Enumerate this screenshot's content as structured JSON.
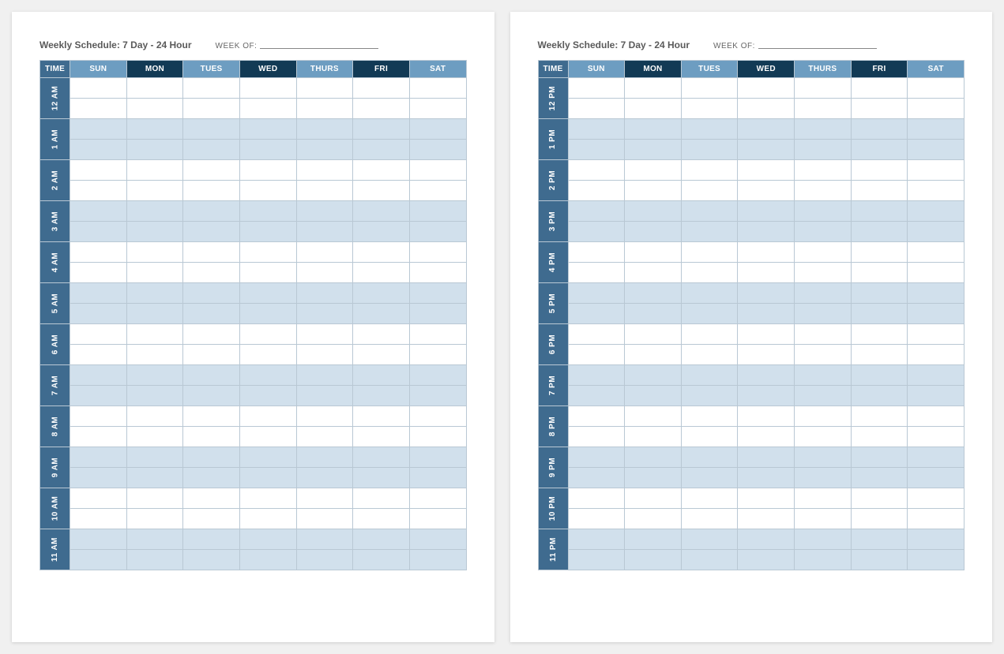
{
  "title": "Weekly Schedule: 7 Day - 24 Hour",
  "week_of_label": "WEEK OF:",
  "headers": {
    "time": "TIME",
    "sun": "SUN",
    "mon": "MON",
    "tue": "TUES",
    "wed": "WED",
    "thu": "THURS",
    "fri": "FRI",
    "sat": "SAT"
  },
  "pages": [
    {
      "hours": [
        "12 AM",
        "1 AM",
        "2 AM",
        "3 AM",
        "4 AM",
        "5 AM",
        "6 AM",
        "7 AM",
        "8 AM",
        "9 AM",
        "10 AM",
        "11 AM"
      ]
    },
    {
      "hours": [
        "12 PM",
        "1 PM",
        "2 PM",
        "3 PM",
        "4 PM",
        "5 PM",
        "6 PM",
        "7 PM",
        "8 PM",
        "9 PM",
        "10 PM",
        "11 PM"
      ]
    }
  ],
  "colors": {
    "time_col": "#3f6b8f",
    "light_day": "#6d9dc1",
    "dark_day": "#123a55",
    "shade_row": "#d1e0ec",
    "grid": "#b9c8d4"
  }
}
